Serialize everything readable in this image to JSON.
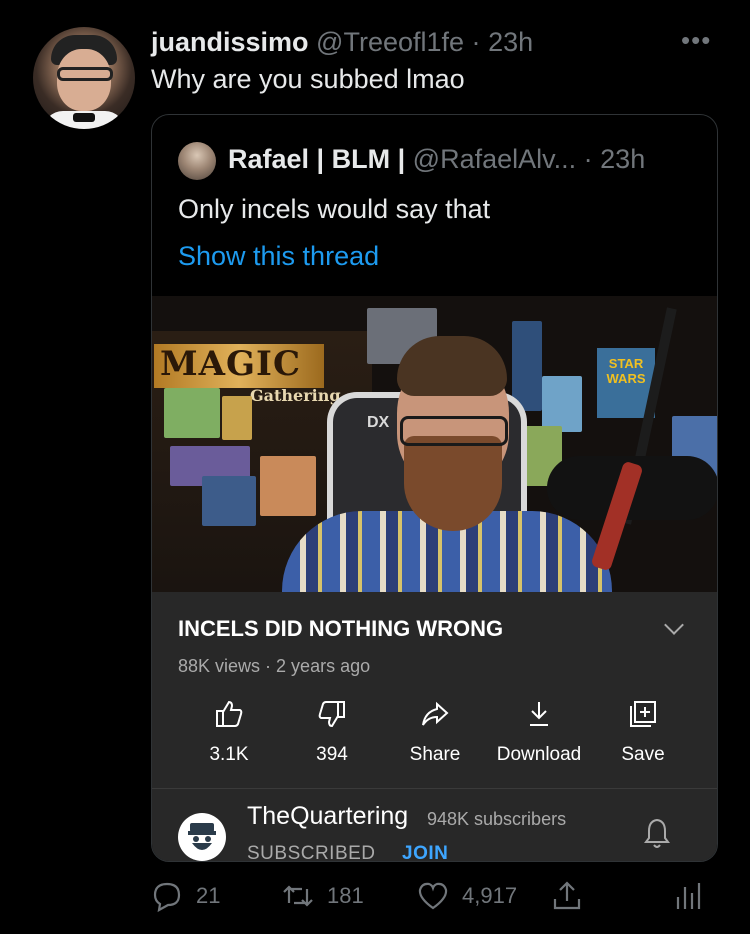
{
  "tweet": {
    "display_name": "juandissimo",
    "handle": "@Treeofl1fe",
    "time": "23h",
    "separator": "·",
    "text": "Why are you subbed lmao",
    "more_icon": "more-dots-icon",
    "stats": {
      "replies": "21",
      "retweets": "181",
      "likes": "4,917"
    }
  },
  "quote": {
    "display_name": "Rafael | BLM |",
    "handle": "@RafaelAlv...",
    "time": "23h",
    "separator": "·",
    "text": "Only incels would say that",
    "show_thread": "Show this thread"
  },
  "video": {
    "magic_text": "MAGIC",
    "gathering_text": "Gathering",
    "chair_logo": "DX",
    "starwars_text": "STAR WARS",
    "title": "INCELS DID NOTHING WRONG",
    "views": "88K views",
    "age": "2 years ago",
    "meta_separator": " · ",
    "actions": [
      {
        "label": "3.1K",
        "icon": "thumbs-up-icon"
      },
      {
        "label": "394",
        "icon": "thumbs-down-icon"
      },
      {
        "label": "Share",
        "icon": "share-arrow-icon"
      },
      {
        "label": "Download",
        "icon": "download-icon"
      },
      {
        "label": "Save",
        "icon": "save-playlist-icon"
      }
    ],
    "channel": {
      "name": "TheQuartering",
      "subscribers": "948K subscribers",
      "subscribed_label": "SUBSCRIBED",
      "join_label": "JOIN"
    }
  },
  "colors": {
    "background": "#000000",
    "primary_text": "#e7e9ea",
    "secondary_text": "#71767b",
    "link": "#1d9bf0",
    "yt_panel": "#282828",
    "yt_join": "#3ea6ff"
  }
}
